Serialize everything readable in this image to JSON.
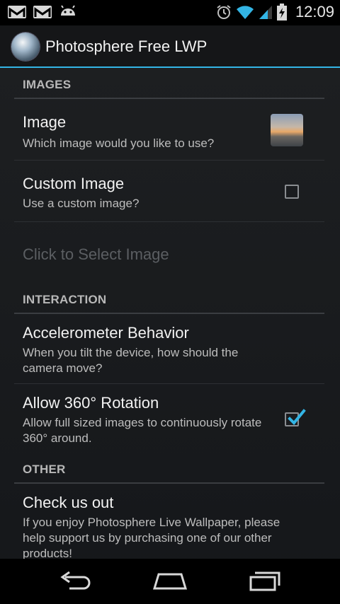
{
  "status_bar": {
    "time": "12:09",
    "icons": [
      "gmail-icon",
      "gmail-icon",
      "android-icon",
      "alarm-icon",
      "wifi-icon",
      "signal-icon",
      "battery-charging-icon"
    ]
  },
  "action_bar": {
    "title": "Photosphere Free LWP",
    "icon": "photosphere-app-icon"
  },
  "sections": {
    "images": {
      "header": "IMAGES",
      "image": {
        "title": "Image",
        "summary": "Which image would you like to use?"
      },
      "custom_image": {
        "title": "Custom Image",
        "summary": "Use a custom image?",
        "checked": false
      },
      "select_image": {
        "title": "Click to Select Image",
        "enabled": false
      }
    },
    "interaction": {
      "header": "INTERACTION",
      "accelerometer": {
        "title": "Accelerometer Behavior",
        "summary": "When you tilt the device, how should the camera move?"
      },
      "rotation": {
        "title": "Allow 360° Rotation",
        "summary": "Allow full sized images to continuously rotate 360° around.",
        "checked": true
      }
    },
    "other": {
      "header": "OTHER",
      "check_us_out": {
        "title": "Check us out",
        "summary": "If you enjoy Photosphere Live Wallpaper, please help support us by purchasing one of our other products!"
      }
    }
  },
  "colors": {
    "accent": "#33b5e5",
    "background": "#1b1d20",
    "text_primary": "#f2f2f2",
    "text_secondary": "#bdbdbd",
    "text_disabled": "#5b5e62"
  },
  "nav_bar": {
    "buttons": [
      "back-icon",
      "home-icon",
      "recent-apps-icon"
    ]
  }
}
